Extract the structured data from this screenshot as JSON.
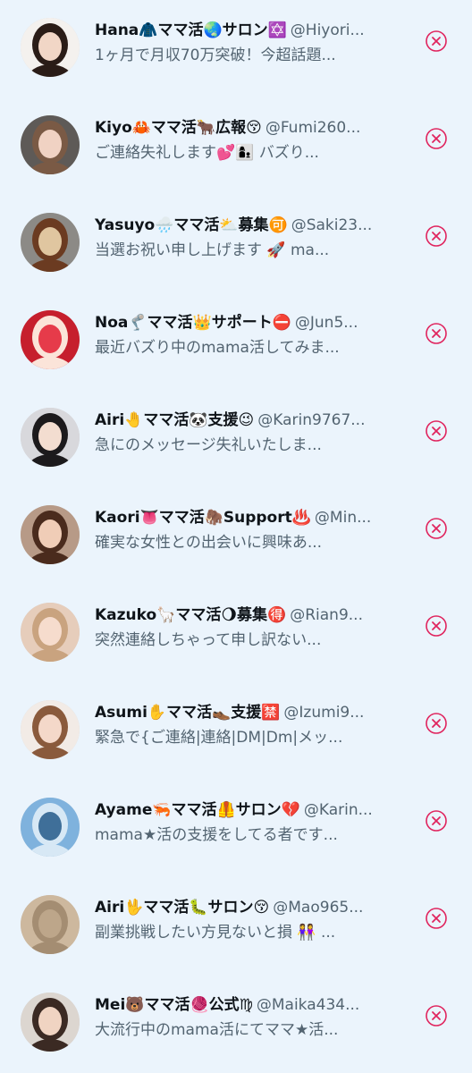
{
  "rows": [
    {
      "name": "Hana🧥ママ活🌏サロン✡️",
      "handle": "@Hiyori...",
      "snippet": "1ヶ月で月収70万突破！今超話題...",
      "avatar": {
        "bg": "#f4f1ee",
        "skin": "#f1d6c6",
        "hair": "#2a1c17"
      }
    },
    {
      "name": "Kiyo🦀ママ活🐂広報😚",
      "handle": "@Fumi260...",
      "snippet": "ご連絡失礼します💕👩‍👦 バズり...",
      "avatar": {
        "bg": "#5e5a57",
        "skin": "#f0d2c3",
        "hair": "#7a5a45"
      }
    },
    {
      "name": "Yasuyo🌧️ママ活⛅募集🉑",
      "handle": "@Saki23...",
      "snippet": "当選お祝い申し上げます 🚀 ma...",
      "avatar": {
        "bg": "#8c8a86",
        "skin": "#e0c6a0",
        "hair": "#6b3b21"
      }
    },
    {
      "name": "Noa🦿ママ活👑サポート⛔",
      "handle": "@Jun5...",
      "snippet": "最近バズり中のmama活してみま...",
      "avatar": {
        "bg": "#c61f2d",
        "skin": "#e63b4a",
        "hair": "#fbe4d9"
      }
    },
    {
      "name": "Airi🤚ママ活🐼支援😉",
      "handle": "@Karin9767...",
      "snippet": "急にのメッセージ失礼いたしま...",
      "avatar": {
        "bg": "#d8d8dc",
        "skin": "#f3ddd0",
        "hair": "#1c1a1c"
      }
    },
    {
      "name": "Kaori👅ママ活🦣Support♨️",
      "handle": "@Min...",
      "snippet": "確実な女性との出会いに興味あ...",
      "avatar": {
        "bg": "#b79a87",
        "skin": "#f0cdb7",
        "hair": "#4a2b1d"
      }
    },
    {
      "name": "Kazuko🦙ママ活🌖募集🉐",
      "handle": "@Rian9...",
      "snippet": "突然連絡しちゃって申し訳ない...",
      "avatar": {
        "bg": "#e6cdbb",
        "skin": "#f6dccd",
        "hair": "#c9a37f"
      }
    },
    {
      "name": "Asumi✋ママ活👞支援🈲",
      "handle": "@Izumi9...",
      "snippet": "緊急で{ご連絡|連絡|DM|Dm|メッ...",
      "avatar": {
        "bg": "#f2ebe6",
        "skin": "#f4d8c9",
        "hair": "#8a5a3c"
      }
    },
    {
      "name": "Ayame🦐ママ活🦺サロン💔",
      "handle": "@Karin...",
      "snippet": "mama★活の支援をしてる者です...",
      "avatar": {
        "bg": "#7fb2dd",
        "skin": "#3f6f99",
        "hair": "#d7e8f5"
      }
    },
    {
      "name": "Airi🖖ママ活🐛サロン😚",
      "handle": "@Mao965...",
      "snippet": "副業挑戦したい方見ないと損 👭 ...",
      "avatar": {
        "bg": "#cdb89e",
        "skin": "#bda68a",
        "hair": "#a48d72"
      }
    },
    {
      "name": "Mei🐻ママ活🧶公式♍",
      "handle": "@Maika434...",
      "snippet": "大流行中のmama活にてママ★活...",
      "avatar": {
        "bg": "#dcd6d0",
        "skin": "#f0d4c2",
        "hair": "#3b2a23"
      }
    }
  ],
  "remove_color": "#e0245e"
}
